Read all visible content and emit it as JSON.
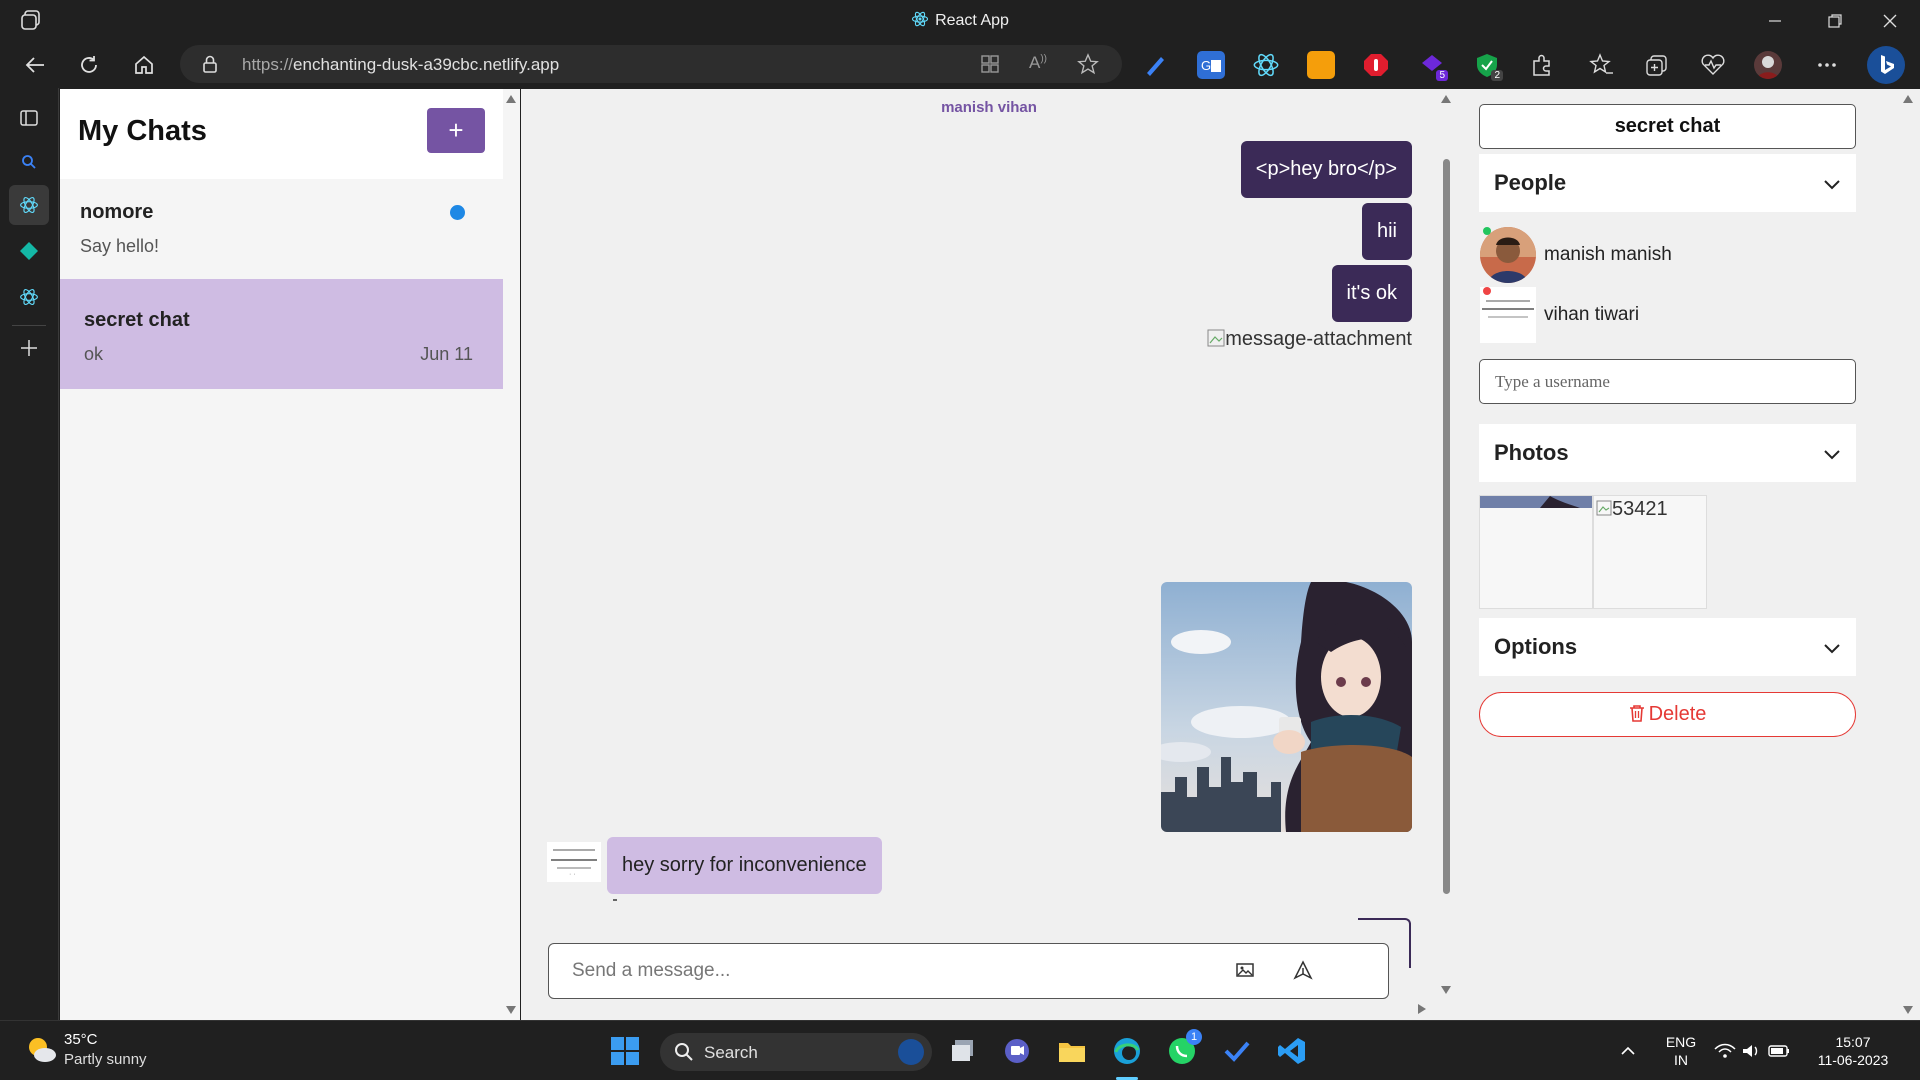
{
  "browser": {
    "tab_title": "React App",
    "url_scheme": "https://",
    "url_host": "enchanting-dusk-a39cbc.netlify.app",
    "extension_badges": {
      "purple_ext": "5",
      "shield_ext": "2"
    }
  },
  "chat_list": {
    "title": "My Chats",
    "new_chat_label": "+",
    "chats": [
      {
        "name": "nomore",
        "last_message": "Say hello!",
        "time": "",
        "unread": true
      },
      {
        "name": "secret chat",
        "last_message": "ok",
        "time": "Jun 11",
        "active": true
      }
    ]
  },
  "feed": {
    "participants_title": "manish vihan",
    "messages_mine": [
      {
        "text": "<p>hey bro</p>"
      },
      {
        "text": "hii"
      },
      {
        "text": "it's ok"
      }
    ],
    "broken_attachment_alt": "message-attachment",
    "message_theirs": "hey sorry for inconvenience",
    "composer_placeholder": "Send a message..."
  },
  "settings": {
    "chat_title": "secret chat",
    "people_label": "People",
    "people": [
      {
        "name": "manish manish",
        "online": true
      },
      {
        "name": "vihan tiwari",
        "online": false
      }
    ],
    "username_placeholder": "Type a username",
    "photos_label": "Photos",
    "photo_alt": "53421",
    "options_label": "Options",
    "delete_label": "Delete"
  },
  "taskbar": {
    "temperature": "35°C",
    "weather": "Partly sunny",
    "search_label": "Search",
    "lang_line1": "ENG",
    "lang_line2": "IN",
    "time": "15:07",
    "date": "11-06-2023",
    "whatsapp_badge": "1"
  },
  "colors": {
    "brand_purple": "#7554a3",
    "bubble_mine": "#3b2a57",
    "bubble_theirs": "#cfbce3",
    "delete_red": "#e53935"
  }
}
